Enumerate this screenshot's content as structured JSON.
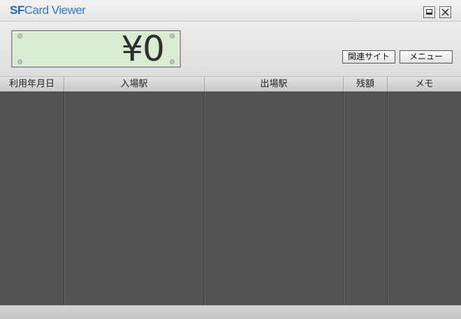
{
  "window": {
    "title_prefix": "SF",
    "title_suffix": "Card Viewer"
  },
  "balance": {
    "amount": "¥0"
  },
  "buttons": {
    "related_sites": "関連サイト",
    "menu": "メニュー"
  },
  "table": {
    "columns": [
      "利用年月日",
      "入場駅",
      "出場駅",
      "残額",
      "メモ"
    ],
    "rows": []
  }
}
